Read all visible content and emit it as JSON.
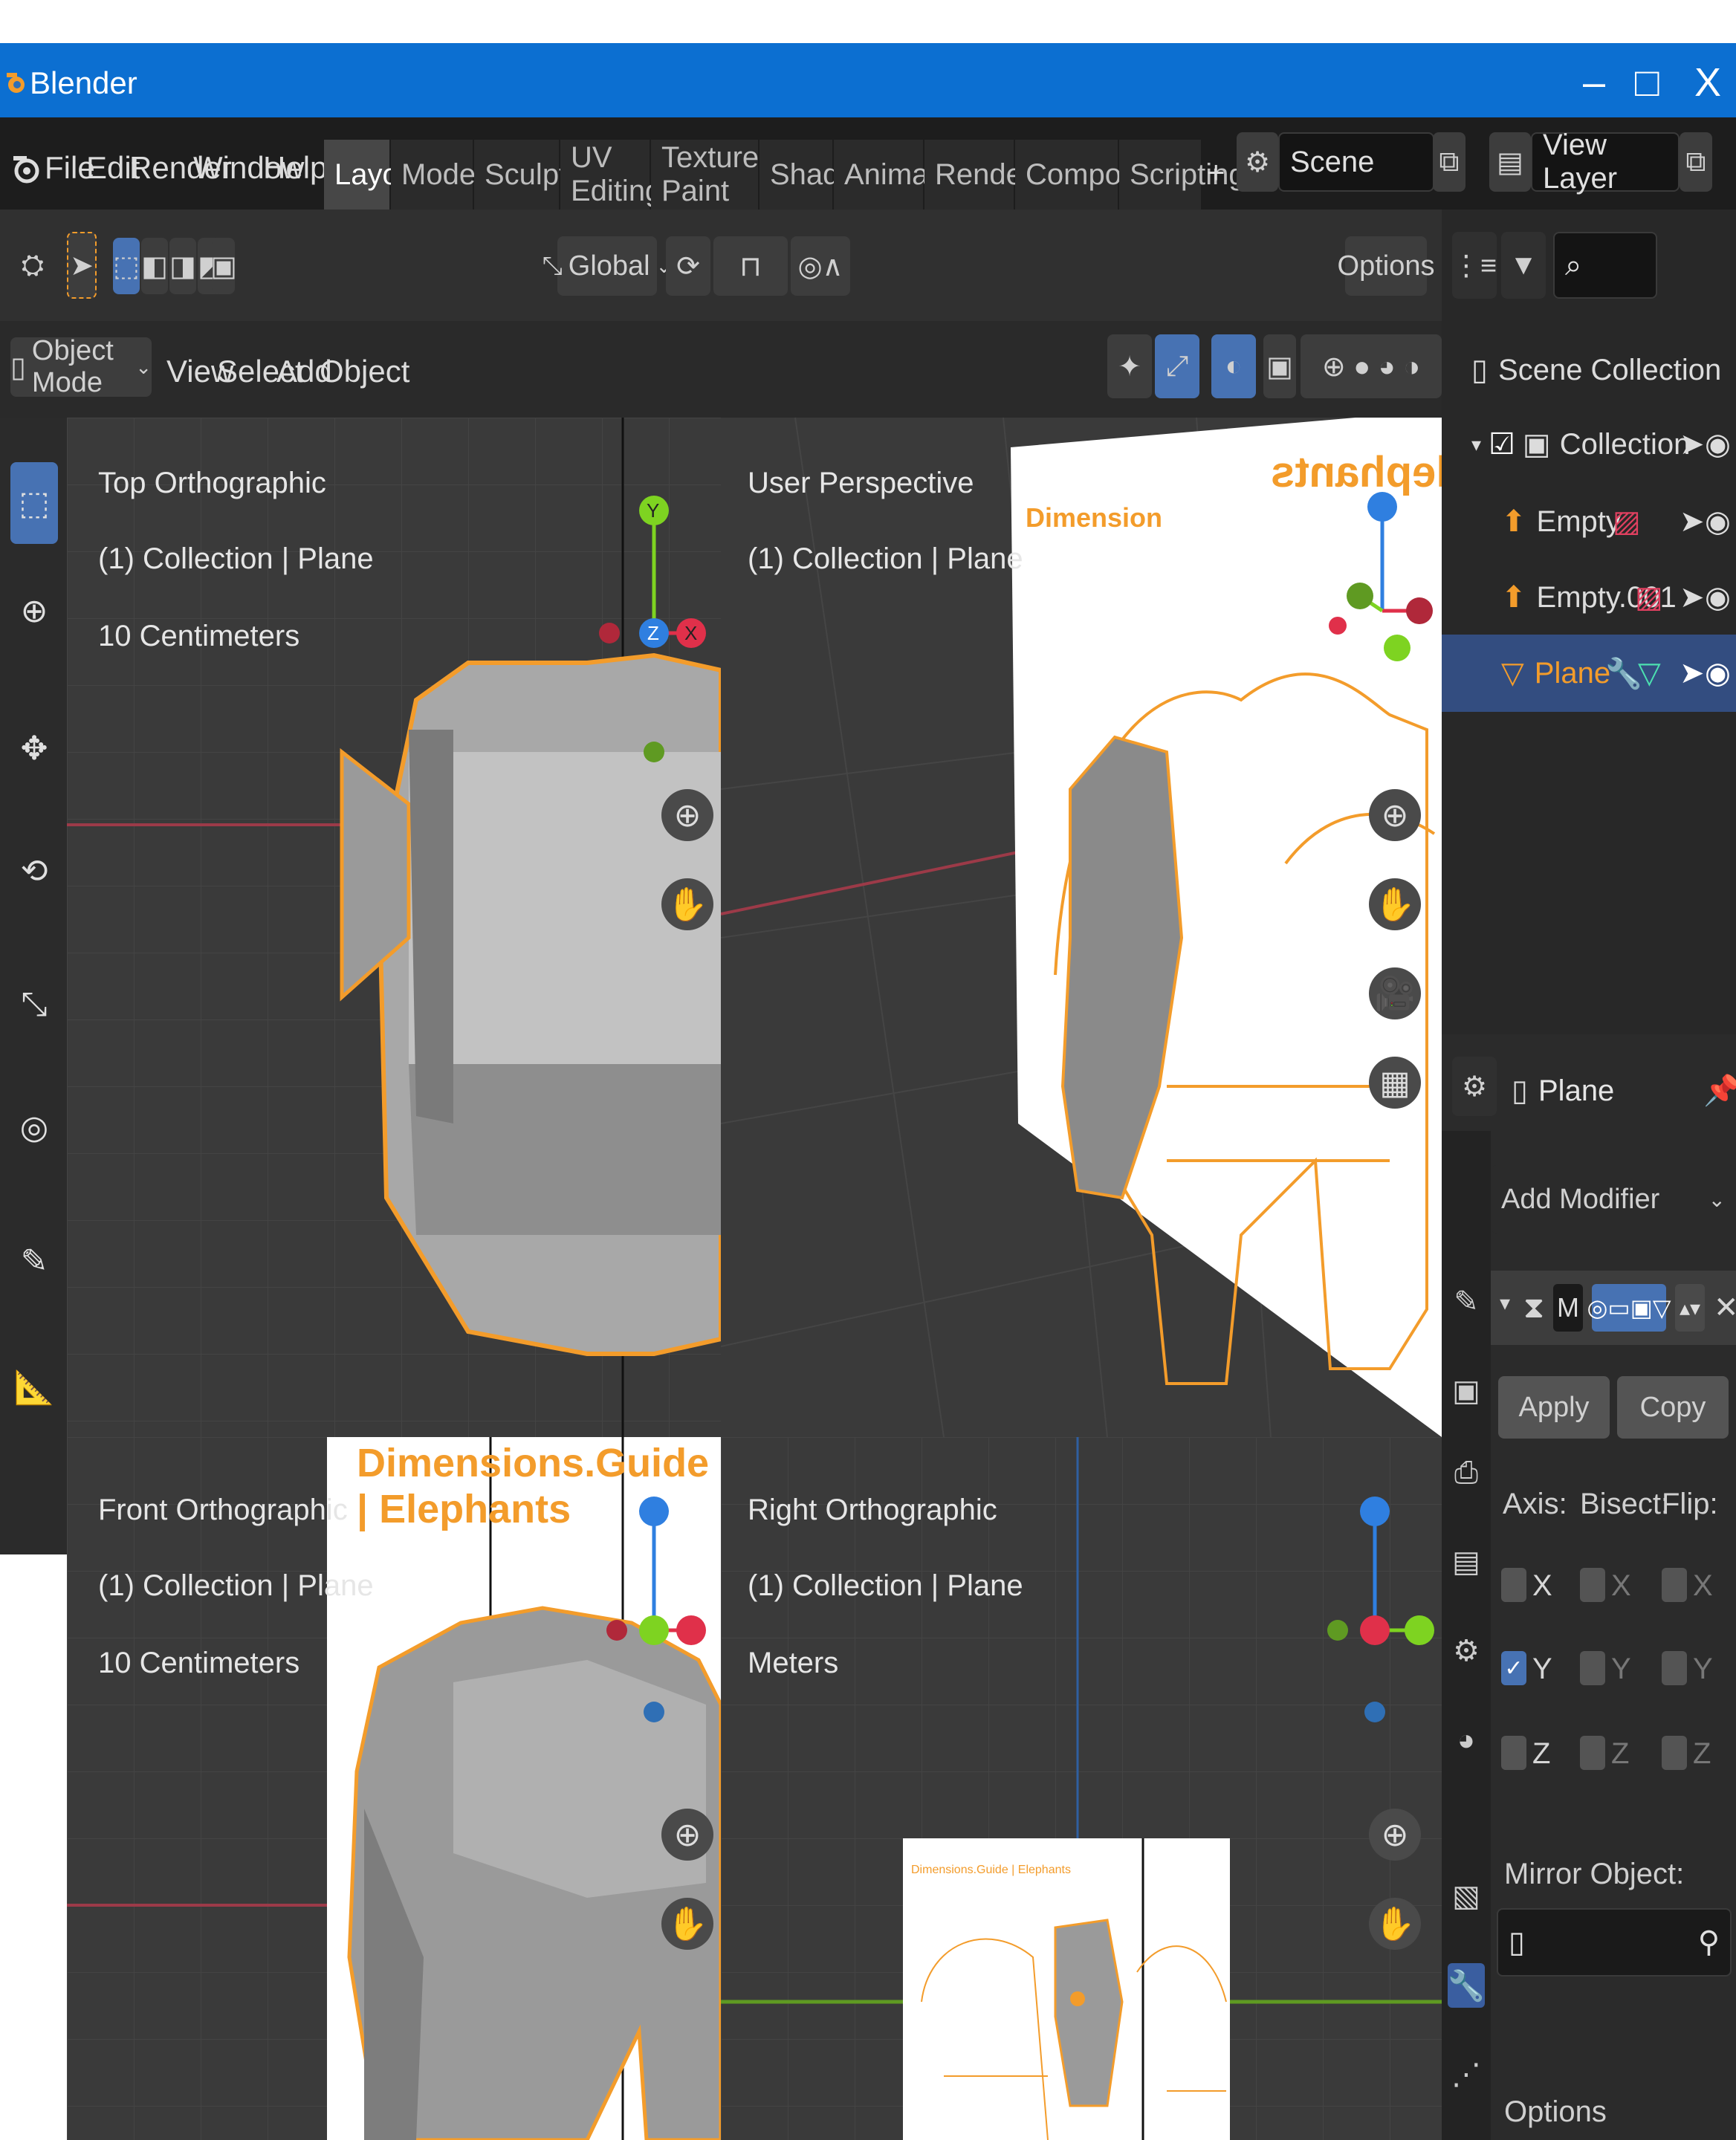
{
  "window": {
    "title": "Blender",
    "minimize": "–",
    "maximize": "□",
    "close": "X"
  },
  "menus": [
    "File",
    "Edit",
    "Render",
    "Window",
    "Help"
  ],
  "workspaces": [
    {
      "label": "Layout",
      "active": true
    },
    {
      "label": "Modeling"
    },
    {
      "label": "Sculpting"
    },
    {
      "label": "UV Editing"
    },
    {
      "label": "Texture Paint"
    },
    {
      "label": "Shading"
    },
    {
      "label": "Animation"
    },
    {
      "label": "Rendering"
    },
    {
      "label": "Compositing"
    },
    {
      "label": "Scripting"
    }
  ],
  "add_workspace": "+",
  "scene": {
    "value": "Scene"
  },
  "view_layer": {
    "value": "View Layer"
  },
  "tool_header": {
    "transform_orientation": "Global",
    "options": "Options"
  },
  "viewport_header": {
    "mode": "Object Mode",
    "menus": [
      "View",
      "Select",
      "Add",
      "Object"
    ]
  },
  "viewports": {
    "top_left": {
      "view": "Top Orthographic",
      "collection": "(1) Collection | Plane",
      "scale": "10 Centimeters"
    },
    "top_right": {
      "view": "User Perspective",
      "collection": "(1) Collection | Plane",
      "image_text": "Dimension",
      "image_title": "Elephants"
    },
    "bottom_left": {
      "view": "Front Orthographic",
      "collection": "(1) Collection | Plane",
      "scale": "10 Centimeters",
      "image_title": "Dimensions.Guide | Elephants"
    },
    "bottom_right": {
      "view": "Right Orthographic",
      "collection": "(1) Collection | Plane",
      "scale": "Meters",
      "image_title": "Dimensions.Guide | Elephants"
    }
  },
  "gizmo_axes": {
    "x": "X",
    "y": "Y",
    "z": "Z"
  },
  "outliner": {
    "search_placeholder": "",
    "scene_collection": "Scene Collection",
    "items": [
      {
        "label": "Collection",
        "indent": 1
      },
      {
        "label": "Empty",
        "indent": 2
      },
      {
        "label": "Empty.001",
        "indent": 2
      },
      {
        "label": "Plane",
        "indent": 2,
        "selected": true
      }
    ]
  },
  "properties": {
    "object_name": "Plane",
    "add_modifier": "Add Modifier",
    "modifier_short": "M",
    "apply": "Apply",
    "copy": "Copy",
    "axis_label": "Axis:",
    "bisect_label": "Bisect:",
    "flip_label": "Flip:",
    "axes": [
      "X",
      "Y",
      "Z"
    ],
    "axis_checked": [
      false,
      true,
      false
    ],
    "mirror_object": "Mirror Object:",
    "options": "Options"
  },
  "colors": {
    "accent": "#4772b3",
    "selection": "#f39c2b",
    "x_axis": "#e0304a",
    "y_axis": "#7ed321",
    "z_axis": "#2f7fe0"
  }
}
